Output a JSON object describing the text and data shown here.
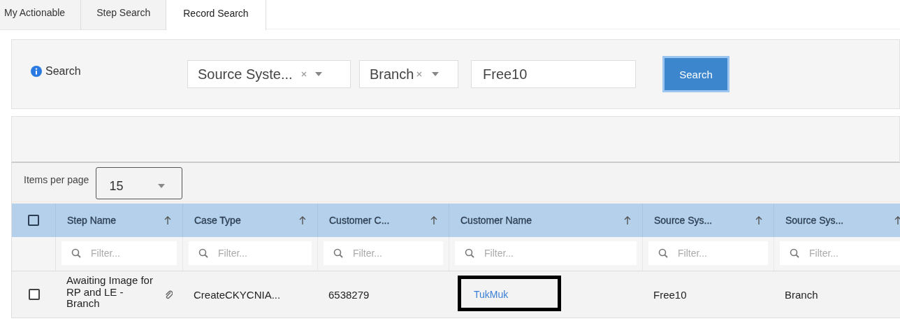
{
  "tabs": [
    {
      "label": "My Actionable",
      "selected": false
    },
    {
      "label": "Step Search",
      "selected": false
    },
    {
      "label": "Record Search",
      "selected": true
    }
  ],
  "search": {
    "label": "Search",
    "filters": [
      {
        "kind": "select",
        "value": "Source Syste...",
        "clearable": true
      },
      {
        "kind": "select",
        "value": "Branch",
        "clearable": true
      },
      {
        "kind": "text",
        "value": "Free10"
      }
    ],
    "button": "Search"
  },
  "pager": {
    "label": "Items per page",
    "value": "15"
  },
  "table": {
    "select_all_checked": false,
    "columns": [
      {
        "label": "Step Name",
        "placeholder": "Filter..."
      },
      {
        "label": "Case Type",
        "placeholder": "Filter..."
      },
      {
        "label": "Customer C...",
        "placeholder": "Filter..."
      },
      {
        "label": "Customer Name",
        "placeholder": "Filter..."
      },
      {
        "label": "Source Sys...",
        "placeholder": "Filter..."
      },
      {
        "label": "Source Sys...",
        "placeholder": "Filter..."
      }
    ],
    "rows": [
      {
        "checked": false,
        "cells": [
          {
            "text": "Awaiting Image for RP and LE - Branch",
            "kind": "attachment",
            "highlighted": false
          },
          {
            "text": "CreateCKYCNIA...",
            "kind": "plain",
            "highlighted": false
          },
          {
            "text": "6538279",
            "kind": "plain",
            "highlighted": false
          },
          {
            "text": "TukMuk",
            "kind": "link",
            "highlighted": true
          },
          {
            "text": "Free10",
            "kind": "plain",
            "highlighted": false
          },
          {
            "text": "Branch",
            "kind": "plain",
            "highlighted": false
          }
        ]
      }
    ]
  }
}
